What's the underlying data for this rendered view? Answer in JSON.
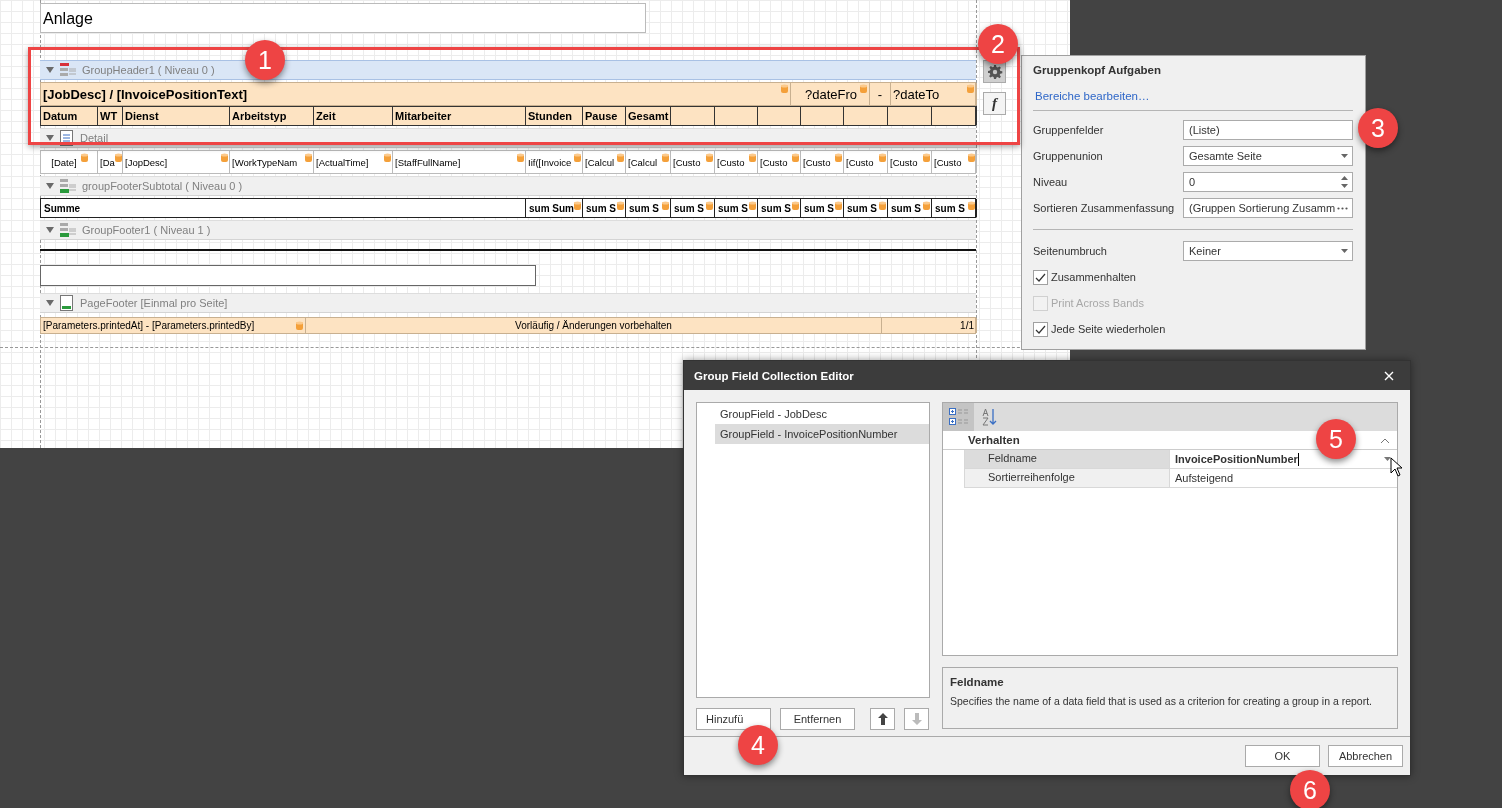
{
  "designer": {
    "top_field": "Anlage",
    "function_button": "f",
    "bands": [
      {
        "kind": "group_header",
        "title": "GroupHeader1 ( Niveau 0 )",
        "selected": true,
        "content": {
          "kind": "header_table",
          "title": "[JobDesc] / [InvoicePositionText]",
          "date_from": "?dateFro",
          "separator": "-",
          "date_to": "?dateTo",
          "columns": [
            "Datum",
            "WT",
            "Dienst",
            "Arbeitstyp",
            "Zeit",
            "Mitarbeiter",
            "Stunden",
            "Pause",
            "Gesamt"
          ]
        }
      },
      {
        "kind": "detail",
        "title": "Detail",
        "selected": false,
        "content": {
          "kind": "field_row",
          "cells": [
            "[Date]",
            "[Da",
            "[JopDesc]",
            "[WorkTypeNam",
            "[ActualTime]",
            "[StaffFullName]",
            "Iif([Invoice",
            "[Calcul",
            "[Calcul",
            "[Custo",
            "[Custo",
            "[Custo",
            "[Custo",
            "[Custo",
            "[Custo",
            "[Custo"
          ]
        }
      },
      {
        "kind": "group_footer",
        "title": "groupFooterSubtotal ( Niveau 0 )",
        "selected": false,
        "content": {
          "kind": "summary_row",
          "label": "Summe",
          "cells": [
            "sum Sum",
            "sum S",
            "sum S",
            "sum S",
            "sum S",
            "sum S",
            "sum S",
            "sum S",
            "sum S",
            "sum S"
          ]
        }
      },
      {
        "kind": "group_footer",
        "title": "GroupFooter1 ( Niveau 1 )",
        "selected": false,
        "content": {
          "kind": "blank"
        }
      },
      {
        "kind": "page_footer",
        "title": "PageFooter [Einmal pro Seite]",
        "selected": false,
        "content": {
          "kind": "footer_row",
          "left": "[Parameters.printedAt] - [Parameters.printedBy]",
          "center": "Vorläufig / Änderungen vorbehalten",
          "right": "1/1"
        }
      }
    ]
  },
  "tasks_panel": {
    "title": "Gruppenkopf Aufgaben",
    "link": "Bereiche bearbeiten…",
    "properties": [
      {
        "kind": "text",
        "label": "Gruppenfelder",
        "value": "(Liste)",
        "separator_before": false
      },
      {
        "kind": "dropdown",
        "label": "Gruppenunion",
        "value": "Gesamte Seite",
        "separator_before": false
      },
      {
        "kind": "spin",
        "label": "Niveau",
        "value": "0",
        "separator_before": false
      },
      {
        "kind": "ellipsis",
        "label": "Sortieren Zusammenfassung",
        "value": "(Gruppen Sortierung Zusamm",
        "separator_before": false
      },
      {
        "kind": "dropdown",
        "label": "Seitenumbruch",
        "value": "Keiner",
        "separator_before": true
      }
    ],
    "options": [
      {
        "label": "Zusammenhalten",
        "checked": true,
        "disabled": false
      },
      {
        "label": "Print Across Bands",
        "checked": false,
        "disabled": true
      },
      {
        "label": "Jede Seite wiederholen",
        "checked": true,
        "disabled": false
      }
    ]
  },
  "dialog": {
    "title": "Group Field Collection Editor",
    "items": [
      {
        "label": "GroupField - JobDesc",
        "selected": false
      },
      {
        "label": "GroupField - InvoicePositionNumber",
        "selected": true
      }
    ],
    "add_button": "Hinzufü",
    "remove_button": "Entfernen",
    "move_buttons": [
      {
        "kind": "up",
        "disabled": false
      },
      {
        "kind": "down",
        "disabled": true
      }
    ],
    "views": [
      {
        "kind": "categorized",
        "selected": true
      },
      {
        "kind": "alphabetical",
        "selected": false
      }
    ],
    "category": "Verhalten",
    "expanded": true,
    "rows": [
      {
        "name": "Feldname",
        "value": "InvoicePositionNumber",
        "kind": "dropdown",
        "selected": true
      },
      {
        "name": "Sortierreihenfolge",
        "value": "Aufsteigend",
        "kind": "text",
        "selected": false
      }
    ],
    "description": {
      "title": "Feldname",
      "text": "Specifies the name of a data field that is used as a criterion for creating a group in a report."
    },
    "ok_button": "OK",
    "cancel_button": "Abbrechen"
  },
  "callouts": [
    "1",
    "2",
    "3",
    "4",
    "5",
    "6"
  ]
}
